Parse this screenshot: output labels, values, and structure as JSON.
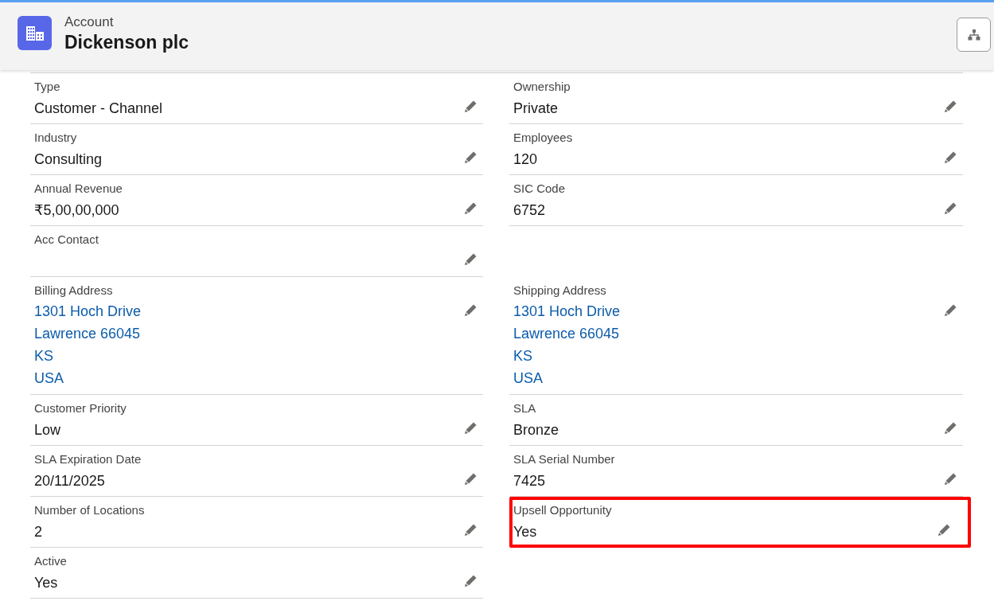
{
  "header": {
    "object_type": "Account",
    "title": "Dickenson plc"
  },
  "rows": [
    {
      "left": {
        "label": "Type",
        "lines": [
          "Customer - Channel"
        ],
        "kind": "text",
        "highlighted": false
      },
      "right": {
        "label": "Ownership",
        "lines": [
          "Private"
        ],
        "kind": "text",
        "highlighted": false
      }
    },
    {
      "left": {
        "label": "Industry",
        "lines": [
          "Consulting"
        ],
        "kind": "text",
        "highlighted": false
      },
      "right": {
        "label": "Employees",
        "lines": [
          "120"
        ],
        "kind": "text",
        "highlighted": false
      }
    },
    {
      "left": {
        "label": "Annual Revenue",
        "lines": [
          "₹5,00,00,000"
        ],
        "kind": "text",
        "highlighted": false
      },
      "right": {
        "label": "SIC Code",
        "lines": [
          "6752"
        ],
        "kind": "text",
        "highlighted": false
      }
    },
    {
      "left": {
        "label": "Acc Contact",
        "kind": "text",
        "highlighted": false
      }
    },
    {
      "left": {
        "label": "Billing Address",
        "lines": [
          "1301 Hoch Drive",
          "Lawrence 66045",
          "KS",
          "USA"
        ],
        "kind": "address",
        "highlighted": false
      },
      "right": {
        "label": "Shipping Address",
        "lines": [
          "1301 Hoch Drive",
          "Lawrence 66045",
          "KS",
          "USA"
        ],
        "kind": "address",
        "highlighted": false
      }
    },
    {
      "left": {
        "label": "Customer Priority",
        "lines": [
          "Low"
        ],
        "kind": "text",
        "highlighted": false
      },
      "right": {
        "label": "SLA",
        "lines": [
          "Bronze"
        ],
        "kind": "text",
        "highlighted": false
      }
    },
    {
      "left": {
        "label": "SLA Expiration Date",
        "lines": [
          "20/11/2025"
        ],
        "kind": "text",
        "highlighted": false
      },
      "right": {
        "label": "SLA Serial Number",
        "lines": [
          "7425"
        ],
        "kind": "text",
        "highlighted": false
      }
    },
    {
      "left": {
        "label": "Number of Locations",
        "lines": [
          "2"
        ],
        "kind": "text",
        "highlighted": false
      },
      "right": {
        "label": "Upsell Opportunity",
        "lines": [
          "Yes"
        ],
        "kind": "text",
        "highlighted": true
      }
    },
    {
      "left": {
        "label": "Active",
        "lines": [
          "Yes"
        ],
        "kind": "text",
        "highlighted": false
      }
    }
  ]
}
